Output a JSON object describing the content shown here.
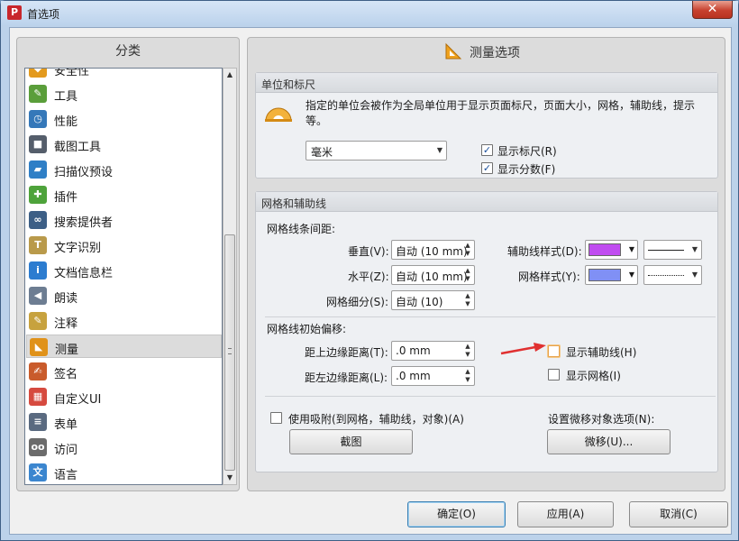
{
  "window": {
    "title": "首选项",
    "close_glyph": "✕"
  },
  "sidebar": {
    "header": "分类",
    "items": [
      {
        "label": "安全性",
        "icon": "shield-icon",
        "color": "#e39a1e"
      },
      {
        "label": "工具",
        "icon": "tools-icon",
        "color": "#5a9e3a"
      },
      {
        "label": "性能",
        "icon": "gauge-icon",
        "color": "#3578b9"
      },
      {
        "label": "截图工具",
        "icon": "camera-icon",
        "color": "#555e6b"
      },
      {
        "label": "扫描仪预设",
        "icon": "scanner-icon",
        "color": "#2f7fc6"
      },
      {
        "label": "插件",
        "icon": "puzzle-icon",
        "color": "#4ea33b"
      },
      {
        "label": "搜索提供者",
        "icon": "binoculars-icon",
        "color": "#3d5f86"
      },
      {
        "label": "文字识别",
        "icon": "ocr-icon",
        "color": "#b99a4b"
      },
      {
        "label": "文档信息栏",
        "icon": "info-icon",
        "color": "#2c7cd0"
      },
      {
        "label": "朗读",
        "icon": "speaker-icon",
        "color": "#6d7d92"
      },
      {
        "label": "注释",
        "icon": "annotation-icon",
        "color": "#c7a23e"
      },
      {
        "label": "测量",
        "icon": "ruler-icon",
        "color": "#e0921a"
      },
      {
        "label": "签名",
        "icon": "signature-icon",
        "color": "#c95b2b"
      },
      {
        "label": "自定义UI",
        "icon": "custom-ui-icon",
        "color": "#d64a3f"
      },
      {
        "label": "表单",
        "icon": "form-icon",
        "color": "#5a6a80"
      },
      {
        "label": "访问",
        "icon": "glasses-icon",
        "color": "#6b6b6b"
      },
      {
        "label": "语言",
        "icon": "language-icon",
        "color": "#3b86cf"
      }
    ],
    "selected_label": "测量"
  },
  "main": {
    "header": "测量选项",
    "units_group": {
      "title": "单位和标尺",
      "description": "指定的单位会被作为全局单位用于显示页面标尺，页面大小，网格，辅助线，提示等。",
      "unit_value": "毫米",
      "show_ruler": {
        "label": "显示标尺(R)",
        "checked": true,
        "check_glyph": "✓"
      },
      "show_fraction": {
        "label": "显示分数(F)",
        "checked": true,
        "check_glyph": "✓"
      }
    },
    "grid_group": {
      "title": "网格和辅助线",
      "spacing_label": "网格线条间距:",
      "vertical_label": "垂直(V):",
      "vertical_value": "自动 (10 mm)",
      "horizontal_label": "水平(Z):",
      "horizontal_value": "自动 (10 mm)",
      "subdivision_label": "网格细分(S):",
      "subdivision_value": "自动 (10)",
      "guide_style_label": "辅助线样式(D):",
      "guide_color": "#c04cf0",
      "grid_style_label": "网格样式(Y):",
      "grid_color": "#8090f5",
      "offset_label": "网格线初始偏移:",
      "top_offset_label": "距上边缘距离(T):",
      "top_offset_value": ".0 mm",
      "left_offset_label": "距左边缘距离(L):",
      "left_offset_value": ".0 mm",
      "show_guides": {
        "label": "显示辅助线(H)",
        "checked": false
      },
      "show_grid": {
        "label": "显示网格(I)",
        "checked": false
      },
      "snap": {
        "label": "使用吸附(到网格，辅助线，对象)(A)",
        "checked": false
      },
      "screenshot_button": "截图",
      "nudge_label": "设置微移对象选项(N):",
      "nudge_button": "微移(U)..."
    }
  },
  "footer": {
    "ok": "确定(O)",
    "apply": "应用(A)",
    "cancel": "取消(C)"
  },
  "accent": {
    "arrow": "#e03030",
    "selection": "#dcdcdc"
  }
}
